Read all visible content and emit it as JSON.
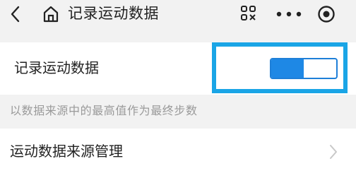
{
  "nav": {
    "title": "记录运动数据",
    "icons": [
      "back-icon",
      "home-icon",
      "scan-icon",
      "more-icon",
      "target-icon"
    ]
  },
  "setting": {
    "label": "记录运动数据",
    "toggle_on": true,
    "toggle_fill": 0.5
  },
  "hint": "以数据来源中的最高值作为最终步数",
  "manage": {
    "label": "运动数据来源管理"
  },
  "colors": {
    "accent": "#1e88e5",
    "highlight": "#1aa5e6",
    "background": "#f2f2f2"
  }
}
